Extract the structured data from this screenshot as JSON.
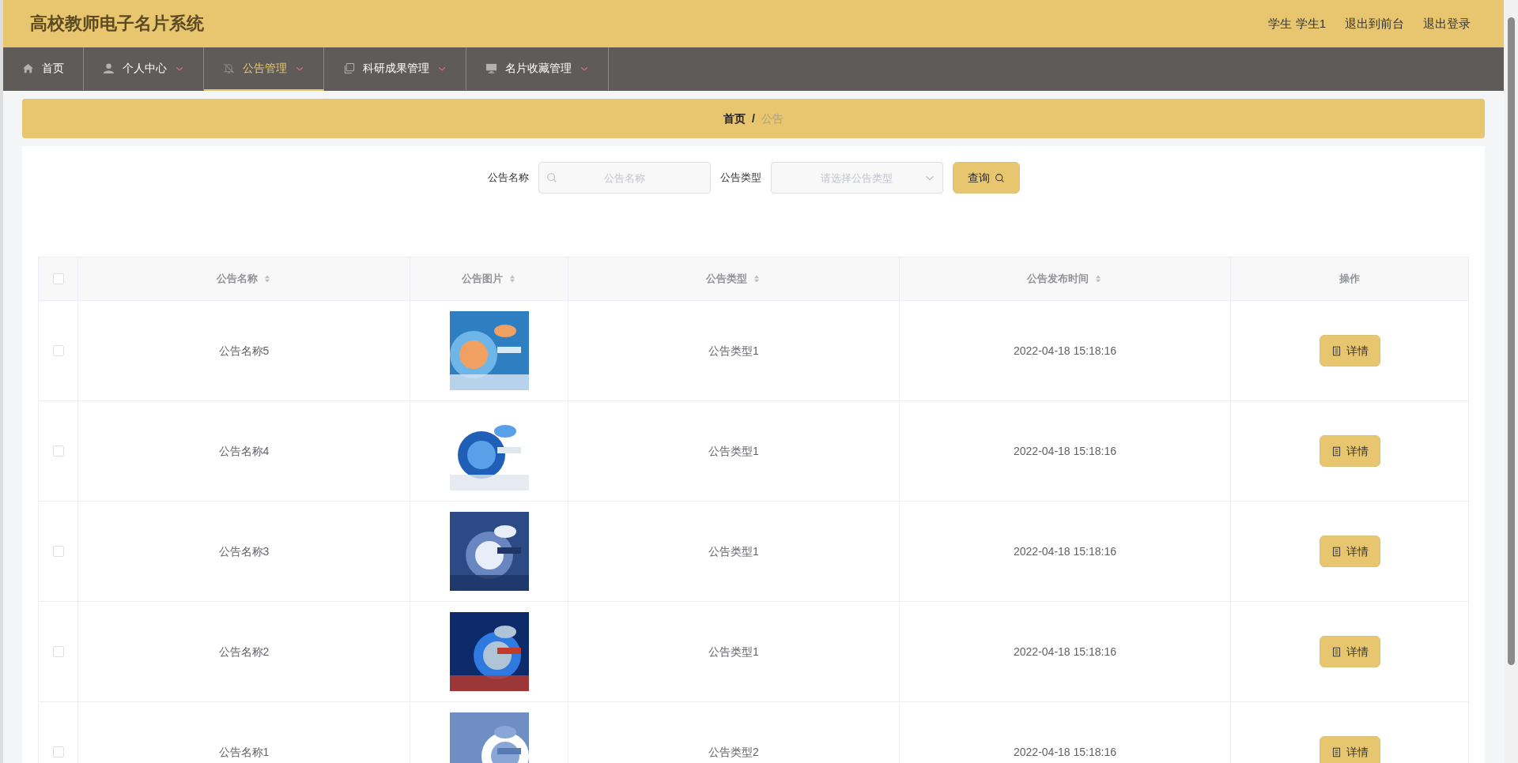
{
  "app_title": "高校教师电子名片系统",
  "header_links": [
    "学生 学生1",
    "退出到前台",
    "退出登录"
  ],
  "nav": [
    {
      "label": "首页",
      "dropdown": false,
      "selected": false
    },
    {
      "label": "个人中心",
      "dropdown": true,
      "selected": false
    },
    {
      "label": "公告管理",
      "dropdown": true,
      "selected": true
    },
    {
      "label": "科研成果管理",
      "dropdown": true,
      "selected": false
    },
    {
      "label": "名片收藏管理",
      "dropdown": true,
      "selected": false
    }
  ],
  "breadcrumb_separator": "/",
  "breadcrumb": [
    {
      "text": "首页",
      "current": false
    },
    {
      "text": "公告",
      "current": true
    }
  ],
  "search": {
    "fields": [
      {
        "label": "公告名称",
        "placeholder": "公告名称",
        "kind": "text"
      },
      {
        "label": "公告类型",
        "placeholder": "请选择公告类型",
        "kind": "select"
      }
    ],
    "button": "查询"
  },
  "table": {
    "select_all_checked": false,
    "columns": [
      {
        "label": "公告名称",
        "sortable": true
      },
      {
        "label": "公告图片",
        "sortable": true
      },
      {
        "label": "公告类型",
        "sortable": true
      },
      {
        "label": "公告发布时间",
        "sortable": true
      },
      {
        "label": "操作",
        "sortable": false
      }
    ],
    "rows": [
      {
        "checked": false,
        "name": "公告名称5",
        "type": "公告类型1",
        "time": "2022-04-18 15:18:16",
        "action": "详情"
      },
      {
        "checked": false,
        "name": "公告名称4",
        "type": "公告类型1",
        "time": "2022-04-18 15:18:16",
        "action": "详情"
      },
      {
        "checked": false,
        "name": "公告名称3",
        "type": "公告类型1",
        "time": "2022-04-18 15:18:16",
        "action": "详情"
      },
      {
        "checked": false,
        "name": "公告名称2",
        "type": "公告类型1",
        "time": "2022-04-18 15:18:16",
        "action": "详情"
      },
      {
        "checked": false,
        "name": "公告名称1",
        "type": "公告类型2",
        "time": "2022-04-18 15:18:16",
        "action": "详情"
      }
    ]
  }
}
